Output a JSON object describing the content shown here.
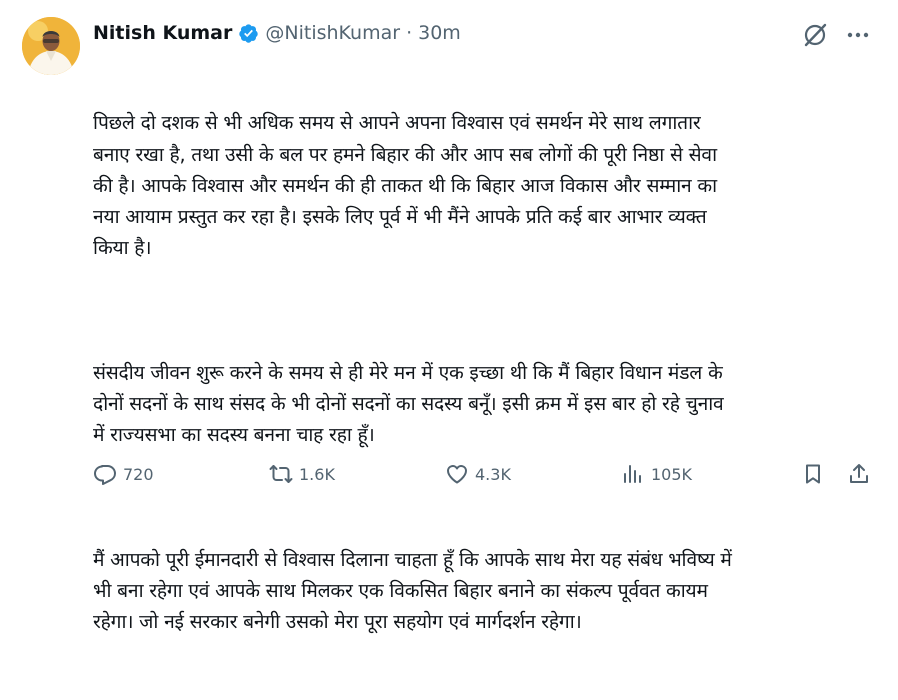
{
  "author": {
    "name": "Nitish Kumar",
    "handle": "@NitishKumar",
    "separator": "·",
    "time": "30m",
    "verified_color": "#1d9bf0"
  },
  "tweet": {
    "paragraphs": [
      "पिछले दो दशक से भी अधिक समय से आपने अपना विश्वास एवं समर्थन मेरे साथ लगातार\nबनाए रखा है, तथा उसी के बल पर हमने बिहार की और आप सब लोगों की पूरी निष्ठा से सेवा\nकी है। आपके विश्वास और समर्थन की ही ताकत थी कि बिहार आज विकास और सम्मान का\nनया आयाम प्रस्तुत कर रहा है। इसके लिए पूर्व में भी मैंने आपके प्रति कई बार आभार व्यक्त\nकिया है।",
      "संसदीय जीवन शुरू करने के समय से ही मेरे मन में एक इच्छा थी कि मैं बिहार विधान मंडल के\nदोनों सदनों के साथ संसद के भी दोनों सदनों का सदस्य बनूँ। इसी क्रम में इस बार हो रहे चुनाव\nमें राज्यसभा का सदस्य बनना चाह रहा हूँ।",
      "मैं आपको पूरी ईमानदारी से विश्वास दिलाना चाहता हूँ कि आपके साथ मेरा यह संबंध भविष्य में\nभी बना रहेगा एवं आपके साथ मिलकर एक विकसित बिहार बनाने का संकल्प पूर्ववत कायम\nरहेगा। जो नई सरकार बनेगी उसको मेरा पूरा सहयोग एवं मार्गदर्शन रहेगा।"
    ]
  },
  "actions": {
    "replies": "720",
    "reposts": "1.6K",
    "likes": "4.3K",
    "views": "105K"
  },
  "icons": {
    "verified": "verified-badge-icon",
    "grok": "grok-icon",
    "more": "more-options-icon",
    "reply": "reply-icon",
    "repost": "repost-icon",
    "like": "heart-icon",
    "views": "views-chart-icon",
    "bookmark": "bookmark-icon",
    "share": "share-icon"
  },
  "colors": {
    "text": "#0f1419",
    "muted": "#536471",
    "accent": "#1d9bf0"
  }
}
